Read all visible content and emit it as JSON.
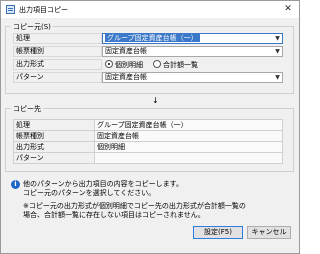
{
  "window": {
    "title": "出力項目コピー",
    "close_glyph": "✕"
  },
  "source": {
    "group_title": "コピー元(S)",
    "rows": [
      {
        "label": "処理",
        "value": "グループ固定資産台帳（一）"
      },
      {
        "label": "帳票種別",
        "value": "固定資産台帳"
      },
      {
        "label": "出力形式",
        "options": [
          "個別明細",
          "合計額一覧"
        ],
        "selected": "個別明細"
      },
      {
        "label": "パターン",
        "value": "固定資産台帳"
      }
    ]
  },
  "arrow": "↓",
  "dest": {
    "group_title": "コピー先",
    "rows": [
      {
        "label": "処理",
        "value": "グループ固定資産台帳（一）"
      },
      {
        "label": "帳票種別",
        "value": "固定資産台帳"
      },
      {
        "label": "出力形式",
        "value": "個別明細"
      },
      {
        "label": "パターン",
        "value": ""
      }
    ]
  },
  "info": {
    "icon": "i",
    "line1": "他のパターンから出力項目の内容をコピーします。",
    "line2": "コピー元のパターンを選択してください。",
    "line3": "※コピー元の出力形式が個別明細でコピー先の出力形式が合計額一覧の",
    "line4": "場合、合計額一覧に存在しない項目はコピーされません。"
  },
  "buttons": {
    "ok": "設定(F5)",
    "cancel": "キャンセル"
  }
}
